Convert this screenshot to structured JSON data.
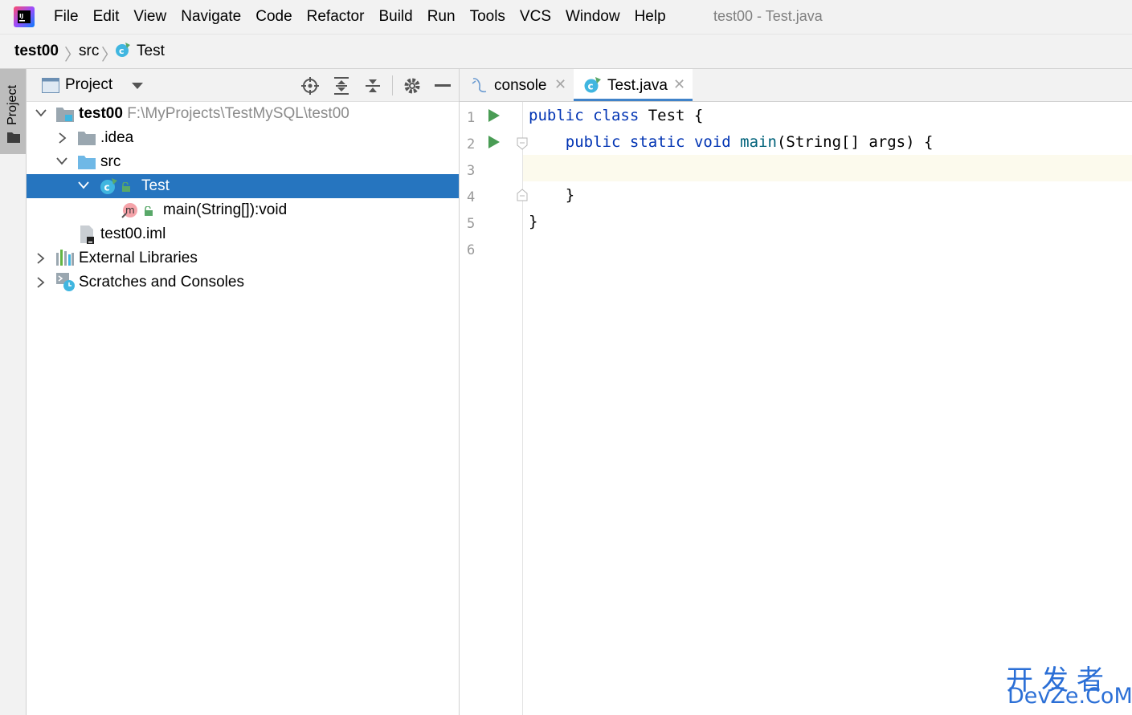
{
  "menubar": {
    "items": [
      "File",
      "Edit",
      "View",
      "Navigate",
      "Code",
      "Refactor",
      "Build",
      "Run",
      "Tools",
      "VCS",
      "Window",
      "Help"
    ],
    "window_title": "test00 - Test.java"
  },
  "breadcrumb": {
    "project": "test00",
    "folder": "src",
    "file": "Test"
  },
  "toolstrip": {
    "project_tab": "Project"
  },
  "project_panel": {
    "title": "Project",
    "tree": [
      {
        "label": "test00",
        "path": "F:\\MyProjects\\TestMySQL\\test00"
      },
      {
        "label": ".idea"
      },
      {
        "label": "src"
      },
      {
        "label": "Test"
      },
      {
        "label": "main(String[]):void"
      },
      {
        "label": "test00.iml"
      },
      {
        "label": "External Libraries"
      },
      {
        "label": "Scratches and Consoles"
      }
    ]
  },
  "editor": {
    "tabs": [
      {
        "label": "console"
      },
      {
        "label": "Test.java"
      }
    ],
    "line_numbers": [
      "1",
      "2",
      "3",
      "4",
      "5",
      "6"
    ],
    "code": {
      "l1_kw1": "public",
      "l1_kw2": "class",
      "l1_rest": " Test {",
      "l2_kw1": "public",
      "l2_kw2": "static",
      "l2_kw3": "void",
      "l2_fn": "main",
      "l2_rest": "(String[] args) {",
      "l4": "}",
      "l5": "}"
    }
  },
  "watermark": {
    "line1": "开发者",
    "line2": "DevZe.CoM"
  },
  "colors": {
    "accent": "#2675bf",
    "keyword": "#0033b3",
    "method": "#00627a",
    "run": "#499c54"
  }
}
